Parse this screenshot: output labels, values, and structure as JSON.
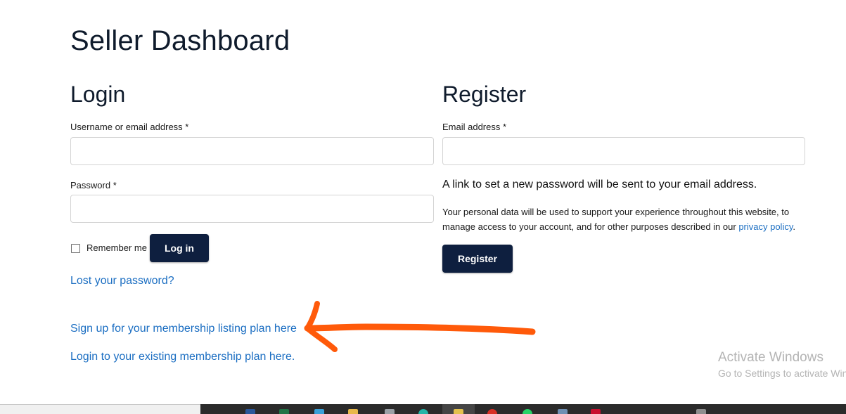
{
  "page": {
    "title": "Seller Dashboard"
  },
  "login": {
    "heading": "Login",
    "username_label": "Username or email address *",
    "username_value": "",
    "password_label": "Password *",
    "password_value": "",
    "remember_label": "Remember me",
    "remember_checked": false,
    "login_button": "Log in",
    "lost_password_link": "Lost your password?"
  },
  "register": {
    "heading": "Register",
    "email_label": "Email address *",
    "email_value": "",
    "password_notice": "A link to set a new password will be sent to your email address.",
    "privacy_text": "Your personal data will be used to support your experience throughout this website, to manage access to your account, and for other purposes described in our ",
    "privacy_link": "privacy policy",
    "privacy_end": ".",
    "register_button": "Register"
  },
  "membership": {
    "signup_link": "Sign up for your membership listing plan here",
    "existing_link": "Login to your existing membership plan here."
  },
  "annotation": {
    "arrow_color": "#ff5a0a",
    "icon": "arrow-left-annotation"
  },
  "watermark": {
    "title": "Activate Windows",
    "subtitle": "Go to Settings to activate Windows."
  },
  "colors": {
    "button_bg": "#0e1f3f",
    "link": "#1b6ec2",
    "text": "#0f1b2c"
  },
  "taskbar": {
    "icons": [
      "word-icon",
      "excel-icon",
      "app-icon",
      "folder-icon",
      "file-icon",
      "edge-icon",
      "pinned-icon",
      "chrome-icon",
      "whatsapp-icon",
      "app2-icon",
      "pdf-icon",
      "notification-icon"
    ]
  }
}
